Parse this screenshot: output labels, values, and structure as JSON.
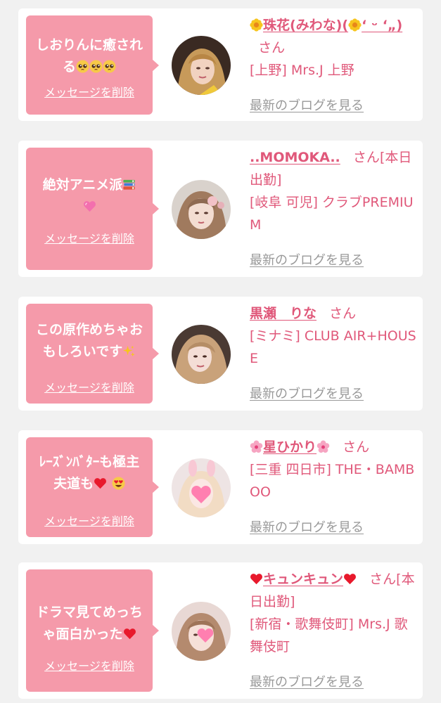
{
  "common": {
    "delete_label": "メッセージを削除",
    "blog_label": "最新のブログを見る",
    "honorific": "さん",
    "accent_color": "#e0587a",
    "bubble_color": "#f59aaa"
  },
  "messages": [
    {
      "text": "しおりんに癒される",
      "text_emoji": [
        "pleading-face-icon",
        "pleading-face-icon",
        "pleading-face-icon"
      ],
      "cast_name_parts": [
        "珠花(みわな)(",
        "‘ ᵕ ‘„)"
      ],
      "cast_name_emoji": [
        "flower-icon",
        "flower-icon"
      ],
      "honorific_suffix": "",
      "shop": "[上野] Mrs.J 上野"
    },
    {
      "text": "絶対アニメ派",
      "text_emoji": [
        "books-icon",
        "pink-heart-icon"
      ],
      "cast_name": "..MOMOKA..",
      "honorific_suffix": "[本日出勤]",
      "shop": "[岐阜 可児] クラブPREMIUM"
    },
    {
      "text": "この原作めちゃおもしろいです",
      "text_emoji": [
        "sparkles-icon"
      ],
      "cast_name": "黒瀬　りな",
      "honorific_suffix": "",
      "shop": "[ミナミ] CLUB AIR+HOUSE"
    },
    {
      "text": "ﾚｰｽﾞﾝﾊﾞﾀｰも極主夫道も",
      "text_emoji": [
        "red-heart-icon",
        "heart-eyes-icon"
      ],
      "cast_name": "星ひかり",
      "cast_name_emoji": [
        "cherry-blossom-icon",
        "cherry-blossom-icon"
      ],
      "honorific_suffix": "",
      "shop": "[三重 四日市] THE・BAMBOO"
    },
    {
      "text": "ドラマ見てめっちゃ面白かった",
      "text_emoji": [
        "red-heart-icon"
      ],
      "cast_name": "キュンキュン",
      "cast_name_emoji": [
        "red-heart-icon",
        "red-heart-icon"
      ],
      "honorific_suffix": "[本日出勤]",
      "shop": "[新宿・歌舞伎町] Mrs.J 歌舞伎町"
    }
  ]
}
